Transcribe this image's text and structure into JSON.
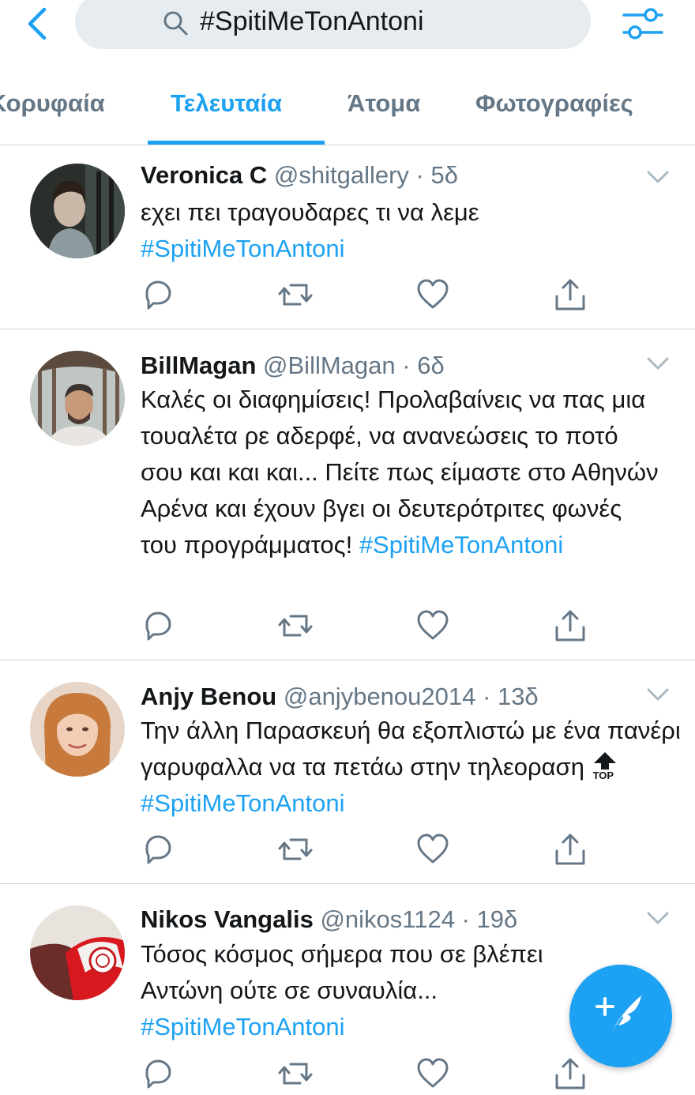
{
  "header": {
    "search_query": "#SpitiMeTonAntoni"
  },
  "tabs": [
    {
      "label": "Κορυφαία"
    },
    {
      "label": "Τελευταία"
    },
    {
      "label": "Άτομα"
    },
    {
      "label": "Φωτογραφίες"
    }
  ],
  "colors": {
    "accent": "#1da1f2",
    "secondary_text": "#657786",
    "divider": "#ccd6dd"
  },
  "tweets": [
    {
      "name": "Veronica C",
      "handle": "@shitgallery",
      "time": "5δ",
      "text": "εχει πει τραγουδαρες τι να λεμε",
      "hashtag": "#SpitiMeTonAntoni"
    },
    {
      "name": "BillMagan",
      "handle": "@BillMagan",
      "time": "6δ",
      "text": "Καλές οι διαφημίσεις! Προλαβαίνεις να πας μια τουαλέτα ρε αδερφέ, να ανανεώσεις το ποτό σου και και και... Πείτε πως είμαστε στο Αθηνών Αρένα και έχουν βγει οι δευτερότριτες φωνές του προγράμματος!",
      "hashtag": "#SpitiMeTonAntoni"
    },
    {
      "name": "Anjy Benou",
      "handle": "@anjybenou2014",
      "time": "13δ",
      "text": "Την άλλη Παρασκευή θα εξοπλιστώ με ένα πανέρι γαρυφαλλα να τα πετάω στην τηλεοραση",
      "emoji_text": "TOP",
      "hashtag": "#SpitiMeTonAntoni"
    },
    {
      "name": "Nikos Vangalis",
      "handle": "@nikos1124",
      "time": "19δ",
      "text": "Τόσος κόσμος σήμερα που σε βλέπει Αντώνη ούτε σε συναυλία...",
      "hashtag": "#SpitiMeTonAntoni"
    }
  ],
  "icons": {
    "back": "chevron-left-icon",
    "search": "search-icon",
    "filter": "filter-sliders-icon",
    "more": "chevron-down-icon",
    "reply": "reply-icon",
    "retweet": "retweet-icon",
    "like": "heart-icon",
    "share": "share-icon",
    "compose": "compose-tweet-icon"
  }
}
